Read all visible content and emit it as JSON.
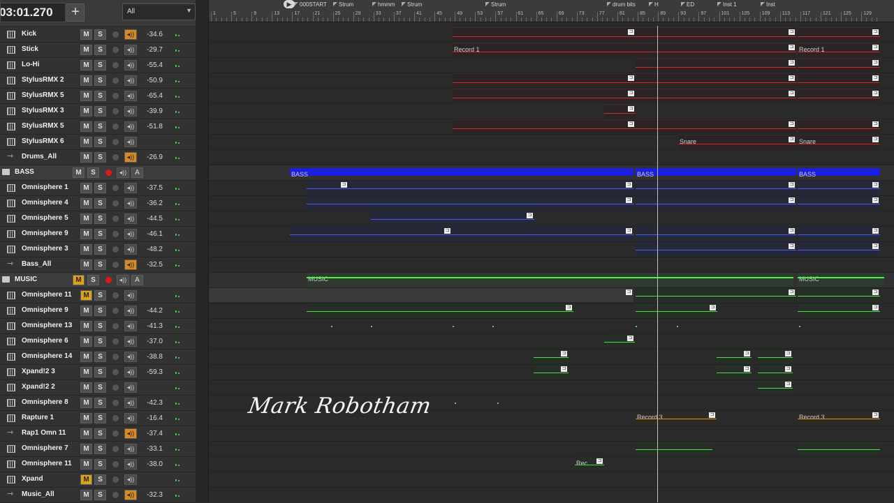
{
  "header": {
    "time": "03:01.270",
    "add_label": "+",
    "filter_value": "All"
  },
  "colors": {
    "mute_active": "#d9a21b",
    "rec_active": "#e01818",
    "drums_clip": "#cc2a2a",
    "bass_clip": "#4a5af0",
    "music_clip": "#4ddc4d",
    "orange_clip": "#d88a20"
  },
  "tracks": [
    {
      "name": "Kick",
      "type": "inst",
      "vol": "-34.6",
      "mon": "on"
    },
    {
      "name": "Stick",
      "type": "inst",
      "vol": "-29.7"
    },
    {
      "name": "Lo-Hi",
      "type": "inst",
      "vol": "-55.4"
    },
    {
      "name": "StylusRMX 2",
      "type": "inst",
      "vol": "-50.9"
    },
    {
      "name": "StylusRMX 5",
      "type": "inst",
      "vol": "-65.4"
    },
    {
      "name": "StylusRMX 3",
      "type": "inst",
      "vol": "-39.9"
    },
    {
      "name": "StylusRMX 5",
      "type": "inst",
      "vol": "-51.8"
    },
    {
      "name": "StylusRMX 6",
      "type": "inst",
      "vol": ""
    },
    {
      "name": "Drums_All",
      "type": "aux",
      "vol": "-26.9",
      "mon": "on"
    },
    {
      "name": "BASS",
      "type": "folder",
      "vol": "",
      "rec": "red"
    },
    {
      "name": "Omnisphere 1",
      "type": "inst",
      "vol": "-37.5"
    },
    {
      "name": "Omnisphere 4",
      "type": "inst",
      "vol": "-36.2"
    },
    {
      "name": "Omnisphere 5",
      "type": "inst",
      "vol": "-44.5"
    },
    {
      "name": "Omnisphere 9",
      "type": "inst",
      "vol": "-46.1"
    },
    {
      "name": "Omnisphere 3",
      "type": "inst",
      "vol": "-48.2"
    },
    {
      "name": "Bass_All",
      "type": "aux",
      "vol": "-32.5",
      "mon": "on"
    },
    {
      "name": "MUSIC",
      "type": "folder",
      "vol": "",
      "rec": "red",
      "mute": "on"
    },
    {
      "name": "Omnisphere 11",
      "type": "inst",
      "vol": "",
      "mute": "on"
    },
    {
      "name": "Omnisphere 9",
      "type": "inst",
      "vol": "-44.2"
    },
    {
      "name": "Omnisphere 13",
      "type": "inst",
      "vol": "-41.3"
    },
    {
      "name": "Omnisphere 6",
      "type": "inst",
      "vol": "-37.0"
    },
    {
      "name": "Omnisphere 14",
      "type": "inst",
      "vol": "-38.8"
    },
    {
      "name": "Xpand!2 3",
      "type": "inst",
      "vol": "-59.3"
    },
    {
      "name": "Xpand!2 2",
      "type": "inst",
      "vol": ""
    },
    {
      "name": "Omnisphere 8",
      "type": "inst",
      "vol": "-42.3"
    },
    {
      "name": "Rapture 1",
      "type": "inst",
      "vol": "-16.4"
    },
    {
      "name": "Rap1 Omn 11",
      "type": "aux",
      "vol": "-37.4",
      "mon": "on"
    },
    {
      "name": "Omnisphere 7",
      "type": "inst",
      "vol": "-33.1"
    },
    {
      "name": "Omnisphere 11",
      "type": "inst",
      "vol": "-38.0"
    },
    {
      "name": "Xpand",
      "type": "inst",
      "vol": "",
      "mute": "on"
    },
    {
      "name": "Music_All",
      "type": "aux",
      "vol": "-32.3",
      "mon": "on"
    }
  ],
  "buttons": {
    "mute": "M",
    "solo": "S",
    "auto": "A"
  },
  "ruler": {
    "numbers": [
      "1",
      "5",
      "9",
      "13",
      "17",
      "21",
      "25",
      "29",
      "33",
      "37",
      "41",
      "45",
      "49",
      "53",
      "57",
      "61",
      "65",
      "69",
      "73",
      "77",
      "81",
      "85",
      "89",
      "93",
      "97",
      "101",
      "105",
      "109",
      "113",
      "117",
      "121",
      "125",
      "129"
    ],
    "markers": [
      "000START",
      "Strum",
      "hmmm",
      "Strum",
      "Strum",
      "drum bits",
      "H",
      "ED",
      "Inst 1",
      "Inst"
    ]
  },
  "clip_labels": {
    "record1": "Record 1",
    "snare": "Snare",
    "bass": "BASS",
    "music": "MUSIC",
    "record3": "Record 3",
    "rec": "Rec"
  },
  "watermark": "Mark Robotham"
}
